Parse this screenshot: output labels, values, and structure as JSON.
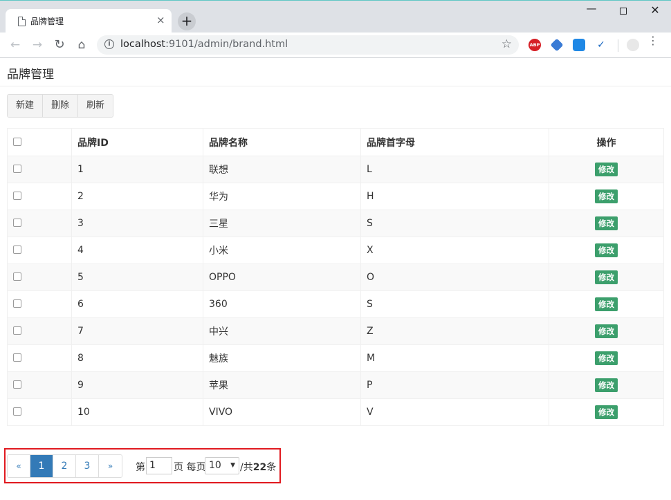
{
  "browser": {
    "tab_title": "品牌管理",
    "tab_close": "×",
    "new_tab": "+",
    "url_host": "localhost",
    "url_path": ":9101/admin/brand.html",
    "ext_abp": "ABP",
    "window_min": "—",
    "window_close": "✕",
    "menu": "⋮"
  },
  "page": {
    "title": "品牌管理"
  },
  "toolbar": {
    "new_label": "新建",
    "delete_label": "删除",
    "refresh_label": "刷新"
  },
  "table": {
    "headers": {
      "id": "品牌ID",
      "name": "品牌名称",
      "first_char": "品牌首字母",
      "op": "操作"
    },
    "edit_label": "修改",
    "rows": [
      {
        "id": "1",
        "name": "联想",
        "first_char": "L"
      },
      {
        "id": "2",
        "name": "华为",
        "first_char": "H"
      },
      {
        "id": "3",
        "name": "三星",
        "first_char": "S"
      },
      {
        "id": "4",
        "name": "小米",
        "first_char": "X"
      },
      {
        "id": "5",
        "name": "OPPO",
        "first_char": "O"
      },
      {
        "id": "6",
        "name": "360",
        "first_char": "S"
      },
      {
        "id": "7",
        "name": "中兴",
        "first_char": "Z"
      },
      {
        "id": "8",
        "name": "魅族",
        "first_char": "M"
      },
      {
        "id": "9",
        "name": "苹果",
        "first_char": "P"
      },
      {
        "id": "10",
        "name": "VIVO",
        "first_char": "V"
      }
    ]
  },
  "pagination": {
    "prev": "«",
    "pages": [
      "1",
      "2",
      "3"
    ],
    "next": "»",
    "active_page": "1",
    "label_page_prefix": "第",
    "current_page_value": "1",
    "label_page_suffix": "页 每页",
    "page_size": "10",
    "label_total_prefix": "/共",
    "total": "22",
    "label_total_suffix": "条"
  }
}
